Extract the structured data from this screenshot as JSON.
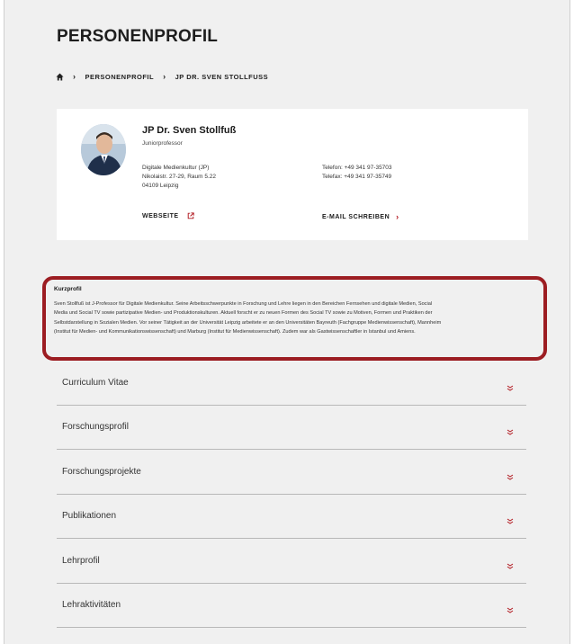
{
  "page": {
    "title": "PERSONENPROFIL"
  },
  "breadcrumb": {
    "home_icon": "home-icon",
    "items": [
      "PERSONENPROFIL",
      "JP DR. SVEN STOLLFUSS"
    ]
  },
  "profile": {
    "name": "JP Dr. Sven Stollfuß",
    "role": "Juniorprofessor",
    "address": [
      "Digitale Medienkultur (JP)",
      "Nikolaistr. 27-29, Raum 5.22",
      "04109 Leipzig"
    ],
    "phone": "Telefon: +49 341 97-35703",
    "fax": "Telefax: +49 341 97-35749",
    "website_label": "WEBSEITE",
    "email_label": "E-MAIL SCHREIBEN"
  },
  "kurzprofil": {
    "title": "Kurzprofil",
    "lines": [
      "Sven Stollfuß ist J-Professor für Digitale Medienkultur. Seine Arbeitsschwerpunkte in Forschung und Lehre liegen in den Bereichen Fernsehen und digitale Medien, Social",
      "Media und Social TV sowie partizipative Medien- und Produktionskulturen. Aktuell forscht er zu neuen Formen des Social TV sowie zu Motiven, Formen und Praktiken der",
      "Selbstdarstellung in Sozialen Medien. Vor seiner Tätigkeit an der Universität Leipzig arbeitete er an den Universitäten Bayreuth (Fachgruppe Medienwissenschaft), Mannheim",
      "(Institut für Medien- und Kommunikationswissenschaft) und Marburg (Institut für Medienwissenschaft). Zudem war als Gastwissenschaftler in Istanbul und Amiens."
    ]
  },
  "accordion": {
    "items": [
      {
        "label": "Curriculum Vitae"
      },
      {
        "label": "Forschungsprofil"
      },
      {
        "label": "Forschungsprojekte"
      },
      {
        "label": "Publikationen"
      },
      {
        "label": "Lehrprofil"
      },
      {
        "label": "Lehraktivitäten"
      }
    ],
    "icon": "expand-chevrons-icon"
  },
  "colors": {
    "accent": "#b1171f",
    "highlight": "#9c1d22",
    "background": "#f0f0f0"
  }
}
